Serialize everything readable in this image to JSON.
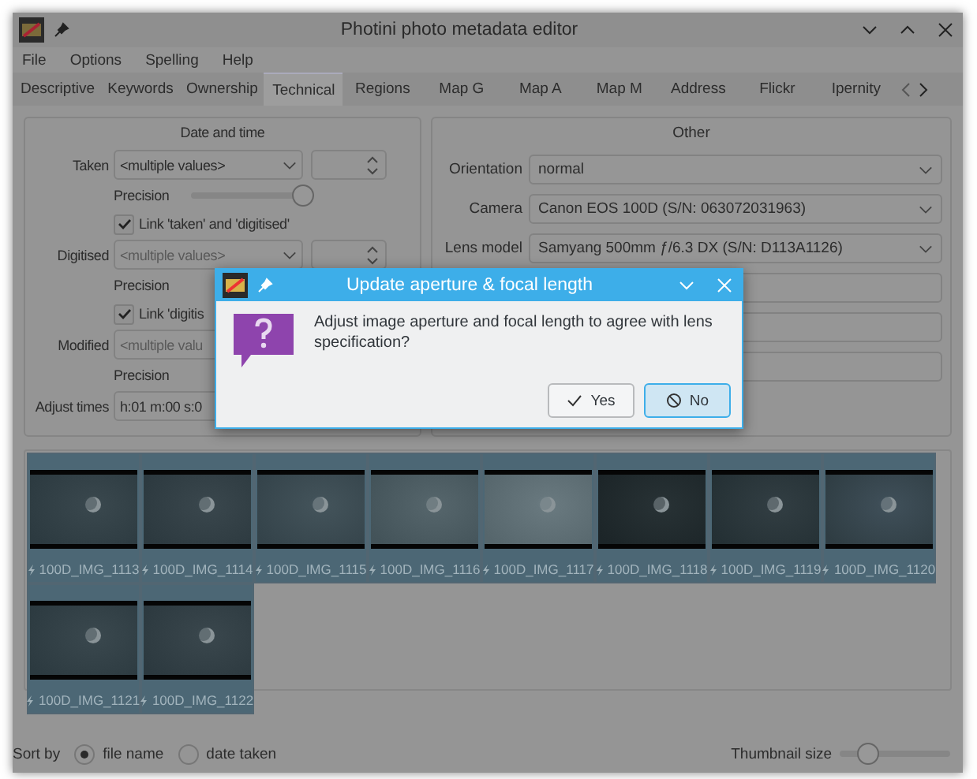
{
  "window": {
    "title": "Photini photo metadata editor"
  },
  "menu": [
    "File",
    "Options",
    "Spelling",
    "Help"
  ],
  "tabs": [
    {
      "label": "Descriptive",
      "selected": false
    },
    {
      "label": "Keywords",
      "selected": false
    },
    {
      "label": "Ownership",
      "selected": false
    },
    {
      "label": "Technical",
      "selected": true
    },
    {
      "label": "Regions",
      "selected": false
    },
    {
      "label": "Map G",
      "selected": false
    },
    {
      "label": "Map A",
      "selected": false
    },
    {
      "label": "Map M",
      "selected": false
    },
    {
      "label": "Address",
      "selected": false
    },
    {
      "label": "Flickr",
      "selected": false
    },
    {
      "label": "Ipernity",
      "selected": false
    }
  ],
  "date_time": {
    "title": "Date and time",
    "rows": [
      {
        "kind": "datetime",
        "label": "Taken",
        "value": "<multiple values>",
        "disabled": false
      },
      {
        "kind": "precision",
        "label": "Precision",
        "level": 1
      },
      {
        "kind": "link",
        "label": "Link 'taken' and 'digitised'",
        "checked": true
      },
      {
        "kind": "datetime",
        "label": "Digitised",
        "value": "<multiple values>",
        "disabled": true
      },
      {
        "kind": "precision",
        "label": "Precision"
      },
      {
        "kind": "link",
        "label": "Link 'digitis",
        "checked": true
      },
      {
        "kind": "datetime_partial",
        "label": "Modified",
        "value": "<multiple valu",
        "disabled": true
      },
      {
        "kind": "precision",
        "label": "Precision"
      },
      {
        "kind": "offset",
        "label": "Adjust times",
        "value": "h:01 m:00 s:0"
      }
    ]
  },
  "other": {
    "title": "Other",
    "rows": [
      {
        "kind": "combo",
        "label": "Orientation",
        "value": "normal"
      },
      {
        "kind": "combo",
        "label": "Camera",
        "value": "Canon EOS 100D (S/N: 063072031963)"
      },
      {
        "kind": "combo",
        "label": "Lens model",
        "value": "Samyang 500mm ƒ/6.3 DX (S/N: D113A1126)"
      },
      {
        "kind": "blank"
      },
      {
        "kind": "blank"
      },
      {
        "kind": "blank"
      }
    ]
  },
  "thumbnails": [
    {
      "name": "100D_IMG_1113",
      "selected": true
    },
    {
      "name": "100D_IMG_1114",
      "selected": true
    },
    {
      "name": "100D_IMG_1115",
      "selected": true
    },
    {
      "name": "100D_IMG_1116",
      "selected": true
    },
    {
      "name": "100D_IMG_1117",
      "selected": true
    },
    {
      "name": "100D_IMG_1118",
      "selected": true
    },
    {
      "name": "100D_IMG_1119",
      "selected": true
    },
    {
      "name": "100D_IMG_1120",
      "selected": true
    },
    {
      "name": "100D_IMG_1121",
      "selected": true
    },
    {
      "name": "100D_IMG_1122",
      "selected": true
    }
  ],
  "sort_by": {
    "label": "Sort by",
    "options": [
      {
        "label": "file name",
        "selected": true
      },
      {
        "label": "date taken",
        "selected": false
      }
    ]
  },
  "thumbnail_size": {
    "label": "Thumbnail size",
    "level": 0.2
  },
  "dialog": {
    "title": "Update aperture & focal length",
    "message": "Adjust image aperture and focal length to agree with lens specification?",
    "buttons": [
      {
        "kind": "yes",
        "label": "Yes",
        "selected": false
      },
      {
        "kind": "no",
        "label": "No",
        "selected": true
      }
    ]
  }
}
